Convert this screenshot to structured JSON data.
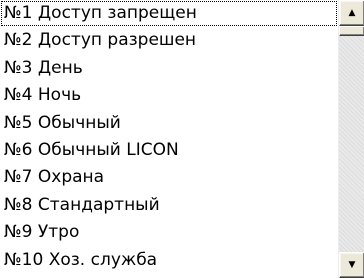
{
  "listbox": {
    "items": [
      {
        "label": "№1 Доступ запрещен"
      },
      {
        "label": "№2 Доступ разрешен"
      },
      {
        "label": "№3 День"
      },
      {
        "label": "№4 Ночь"
      },
      {
        "label": "№5 Обычный"
      },
      {
        "label": "№6 Обычный LICON"
      },
      {
        "label": "№7 Охрана"
      },
      {
        "label": "№8 Стандартный"
      },
      {
        "label": "№9 Утро"
      },
      {
        "label": "№10 Хоз. служба"
      }
    ],
    "focused_index": 0
  },
  "scrollbar": {
    "up_icon": "▲",
    "down_icon": "▼",
    "position": 0
  }
}
